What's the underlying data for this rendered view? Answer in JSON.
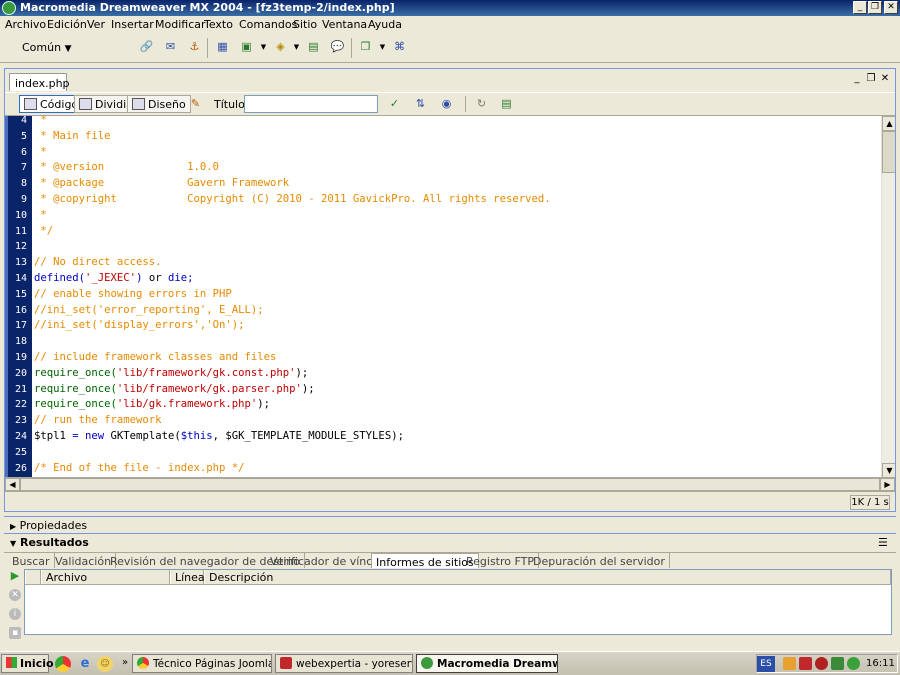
{
  "window": {
    "title": "Macromedia Dreamweaver MX 2004 - [fz3temp-2/index.php]",
    "buttons": {
      "minimize": "_",
      "restore": "❐",
      "close": "✕"
    }
  },
  "menu": [
    "Archivo",
    "Edición",
    "Ver",
    "Insertar",
    "Modificar",
    "Texto",
    "Comandos",
    "Sitio",
    "Ventana",
    "Ayuda"
  ],
  "insert_toolbar": {
    "category": "Común",
    "icons": [
      "hyperlink-icon",
      "email-link-icon",
      "named-anchor-icon",
      "table-icon",
      "image-icon",
      "media-icon",
      "date-icon",
      "comment-icon",
      "templates-icon",
      "tag-chooser-icon"
    ]
  },
  "document": {
    "tab": "index.php",
    "views": {
      "code": "Código",
      "split": "Dividir",
      "design": "Diseño"
    },
    "title_label": "Título:",
    "title_value": "",
    "size_info": "1K / 1 s"
  },
  "code": {
    "lines": [
      {
        "n": "4",
        "parts": [
          {
            "t": " *",
            "c": "#e68a00"
          }
        ]
      },
      {
        "n": "5",
        "parts": [
          {
            "t": " * Main file",
            "c": "#e68a00"
          }
        ]
      },
      {
        "n": "6",
        "parts": [
          {
            "t": " *",
            "c": "#e68a00"
          }
        ]
      },
      {
        "n": "7",
        "parts": [
          {
            "t": " * @version             1.0.0",
            "c": "#e68a00"
          }
        ]
      },
      {
        "n": "8",
        "parts": [
          {
            "t": " * @package             Gavern Framework",
            "c": "#e68a00"
          }
        ]
      },
      {
        "n": "9",
        "parts": [
          {
            "t": " * @copyright           Copyright (C) 2010 - 2011 GavickPro. All rights reserved.",
            "c": "#e68a00"
          }
        ]
      },
      {
        "n": "10",
        "parts": [
          {
            "t": " *",
            "c": "#e68a00"
          }
        ]
      },
      {
        "n": "11",
        "parts": [
          {
            "t": " */",
            "c": "#e68a00"
          }
        ]
      },
      {
        "n": "12",
        "parts": []
      },
      {
        "n": "13",
        "parts": [
          {
            "t": "// No direct access.",
            "c": "#e68a00"
          }
        ]
      },
      {
        "n": "14",
        "parts": [
          {
            "t": "defined(",
            "c": "#0000c0"
          },
          {
            "t": "'_JEXEC'",
            "c": "#c00000"
          },
          {
            "t": ") ",
            "c": "#0000c0"
          },
          {
            "t": "or",
            "c": "#000000"
          },
          {
            "t": " die;",
            "c": "#0000c0"
          }
        ]
      },
      {
        "n": "15",
        "parts": [
          {
            "t": "// enable showing errors in PHP",
            "c": "#e68a00"
          }
        ]
      },
      {
        "n": "16",
        "parts": [
          {
            "t": "//ini_set('error_reporting', E_ALL);",
            "c": "#e68a00"
          }
        ]
      },
      {
        "n": "17",
        "parts": [
          {
            "t": "//ini_set('display_errors','On');",
            "c": "#e68a00"
          }
        ]
      },
      {
        "n": "18",
        "parts": []
      },
      {
        "n": "19",
        "parts": [
          {
            "t": "// include framework classes and files",
            "c": "#e68a00"
          }
        ]
      },
      {
        "n": "20",
        "parts": [
          {
            "t": "require_once(",
            "c": "#006400"
          },
          {
            "t": "'lib/framework/gk.const.php'",
            "c": "#c00000"
          },
          {
            "t": ");",
            "c": "#000000"
          }
        ]
      },
      {
        "n": "21",
        "parts": [
          {
            "t": "require_once(",
            "c": "#006400"
          },
          {
            "t": "'lib/framework/gk.parser.php'",
            "c": "#c00000"
          },
          {
            "t": ");",
            "c": "#000000"
          }
        ]
      },
      {
        "n": "22",
        "parts": [
          {
            "t": "require_once(",
            "c": "#006400"
          },
          {
            "t": "'lib/gk.framework.php'",
            "c": "#c00000"
          },
          {
            "t": ");",
            "c": "#000000"
          }
        ]
      },
      {
        "n": "23",
        "parts": [
          {
            "t": "// run the framework",
            "c": "#e68a00"
          }
        ]
      },
      {
        "n": "24",
        "parts": [
          {
            "t": "$tpl1",
            "c": "#000000"
          },
          {
            "t": " = ",
            "c": "#0000c0"
          },
          {
            "t": "new",
            "c": "#0000c0"
          },
          {
            "t": " GKTemplate(",
            "c": "#000000"
          },
          {
            "t": "$this",
            "c": "#0000c0"
          },
          {
            "t": ", $GK_TEMPLATE_MODULE_STYLES);",
            "c": "#000000"
          }
        ]
      },
      {
        "n": "25",
        "parts": []
      },
      {
        "n": "26",
        "parts": [
          {
            "t": "/* End of the file - index.php */",
            "c": "#e68a00"
          }
        ]
      }
    ]
  },
  "panels": {
    "properties": "Propiedades",
    "results": "Resultados",
    "result_tabs": [
      "Buscar",
      "Validación",
      "Revisión del navegador de destino",
      "Verificador de vínculos",
      "Informes de sitios",
      "Registro FTP",
      "Depuración del servidor"
    ],
    "active_tab": "Informes de sitios",
    "columns": [
      "Archivo",
      "Línea",
      "Descripción"
    ]
  },
  "taskbar": {
    "start": "Inicio",
    "tasks": [
      {
        "label": "Técnico Páginas Joomla :...",
        "active": false,
        "color": "#d8452a"
      },
      {
        "label": "webexpertia - yoreserv...",
        "active": false,
        "color": "#c0282c"
      },
      {
        "label": "Macromedia Dreamwe...",
        "active": true,
        "color": "#3c9a3c"
      }
    ],
    "lang": "ES",
    "time": "16:11"
  }
}
